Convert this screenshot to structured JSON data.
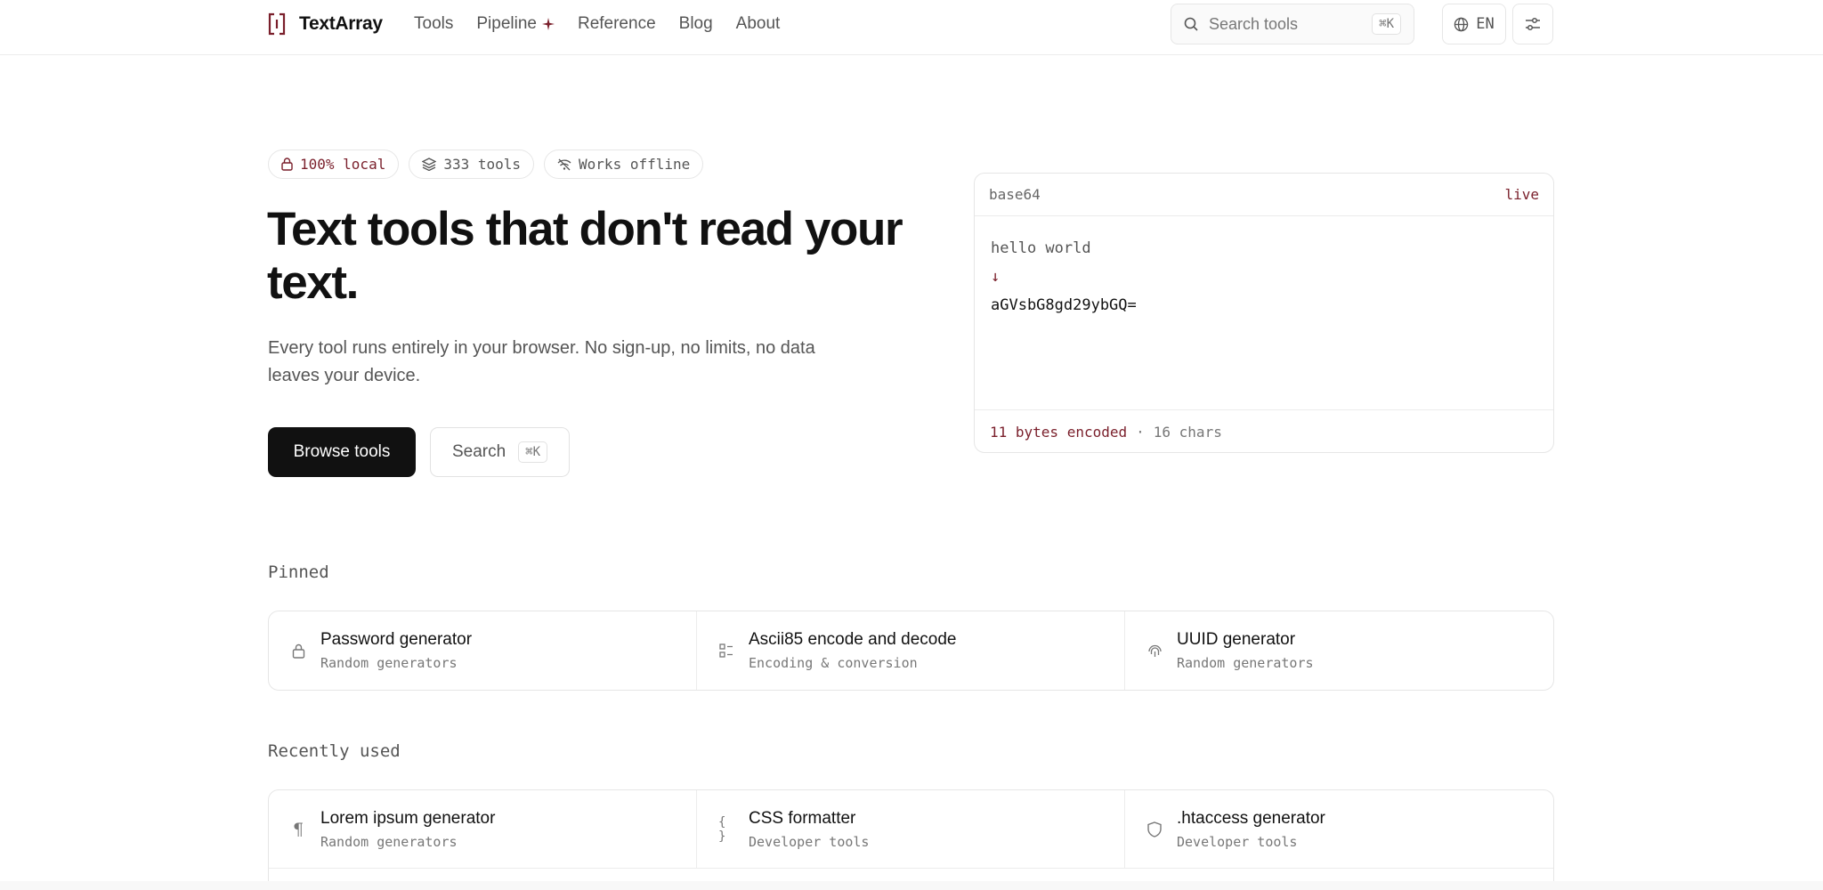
{
  "header": {
    "brand": "TextArray",
    "nav": [
      "Tools",
      "Pipeline",
      "Reference",
      "Blog",
      "About"
    ],
    "search_placeholder": "Search tools",
    "search_shortcut": "⌘K",
    "language": "EN"
  },
  "hero": {
    "badges": [
      "100% local",
      "333 tools",
      "Works offline"
    ],
    "title": "Text tools that don't read your text.",
    "subtitle": "Every tool runs entirely in your browser. No sign-up, no limits, no data leaves your device.",
    "primary_button": "Browse tools",
    "secondary_button": "Search",
    "secondary_shortcut": "⌘K"
  },
  "demo": {
    "tool": "base64",
    "status": "live",
    "input": "hello world",
    "arrow": "↓",
    "output": "aGVsbG8gd29ybGQ=",
    "stat_bytes": "11 bytes encoded",
    "separator": "·",
    "stat_chars": "16 chars"
  },
  "pinned": {
    "title": "Pinned",
    "items": [
      {
        "name": "Password generator",
        "category": "Random generators",
        "icon": "lock-icon"
      },
      {
        "name": "Ascii85 encode and decode",
        "category": "Encoding & conversion",
        "icon": "blocks-icon"
      },
      {
        "name": "UUID generator",
        "category": "Random generators",
        "icon": "fingerprint-icon"
      }
    ]
  },
  "recent": {
    "title": "Recently used",
    "items": [
      {
        "name": "Lorem ipsum generator",
        "category": "Random generators",
        "icon": "pilcrow-icon"
      },
      {
        "name": "CSS formatter",
        "category": "Developer tools",
        "icon": "braces-icon"
      },
      {
        "name": ".htaccess generator",
        "category": "Developer tools",
        "icon": "shield-icon"
      }
    ]
  },
  "colors": {
    "accent": "#7a1f2b",
    "primary_button": "#111111",
    "border": "#e6e6e6"
  }
}
